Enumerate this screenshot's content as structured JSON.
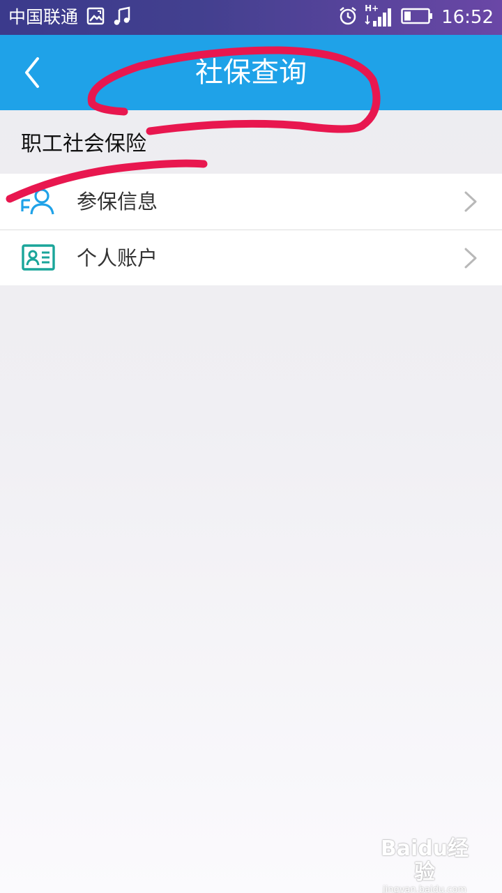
{
  "status_bar": {
    "carrier": "中国联通",
    "time": "16:52",
    "network": "H+",
    "icons": [
      "image-icon",
      "music-note-icon",
      "alarm-icon",
      "signal-icon",
      "battery-icon"
    ]
  },
  "header": {
    "title": "社保查询",
    "back_icon": "chevron-left-icon",
    "background": "#1fa2e8"
  },
  "section": {
    "label": "职工社会保险"
  },
  "menu": {
    "items": [
      {
        "label": "参保信息",
        "icon": "people-icon",
        "icon_color": "#1fa2e8",
        "chevron": "chevron-right-icon"
      },
      {
        "label": "个人账户",
        "icon": "id-card-icon",
        "icon_color": "#1aa59a",
        "chevron": "chevron-right-icon"
      }
    ]
  },
  "annotation": {
    "color": "#e8174f"
  },
  "watermark": {
    "logo": "Baidu经验",
    "url": "jingyan.baidu.com"
  }
}
